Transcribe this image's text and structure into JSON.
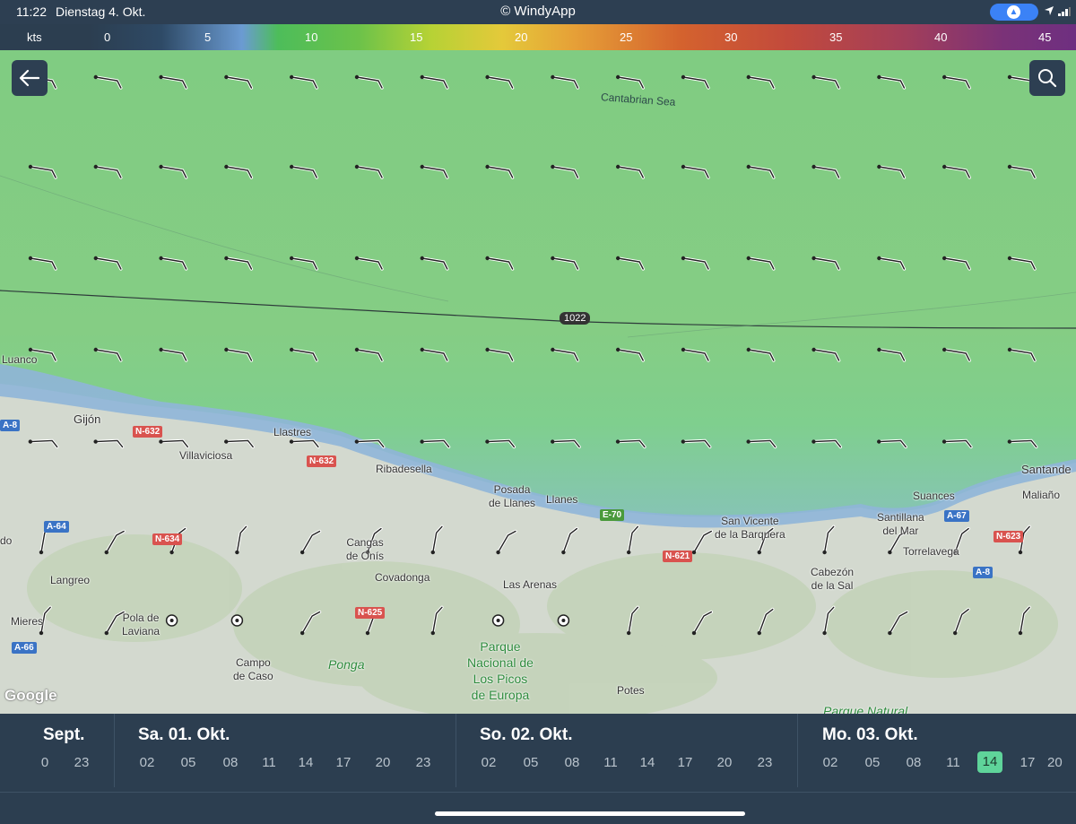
{
  "status_bar": {
    "time": "11:22",
    "date": "Dienstag 4. Okt.",
    "app_title": "© WindyApp"
  },
  "legend": {
    "unit": "kts",
    "ticks": [
      "0",
      "5",
      "10",
      "15",
      "20",
      "25",
      "30",
      "35",
      "40",
      "45"
    ]
  },
  "map": {
    "sea_name": "Cantabrian Sea",
    "isobar_value": "1022",
    "attribution": "Google",
    "places": {
      "luanco": "Luanco",
      "gijon": "Gijón",
      "villaviciosa": "Villaviciosa",
      "llastres": "Llastres",
      "ribadesella": "Ribadesella",
      "posada_1": "Posada",
      "posada_2": "de Llanes",
      "llanes": "Llanes",
      "san_vicente_1": "San Vicente",
      "san_vicente_2": "de la Barquera",
      "suances": "Suances",
      "santander": "Santande",
      "maliano": "Maliaño",
      "santillana_1": "Santillana",
      "santillana_2": "del Mar",
      "torrelavega": "Torrelavega",
      "cangas_1": "Cangas",
      "cangas_2": "de Onís",
      "covadonga": "Covadonga",
      "las_arenas": "Las Arenas",
      "cabezon_1": "Cabezón",
      "cabezon_2": "de la Sal",
      "langreo": "Langreo",
      "mieres": "Mieres",
      "pola_1": "Pola de",
      "pola_2": "Laviana",
      "campo_1": "Campo",
      "campo_2": "de Caso",
      "ponga": "Ponga",
      "park_1": "Parque",
      "park_2": "Nacional de",
      "park_3": "Los Picos",
      "park_4": "de Europa",
      "potes": "Potes",
      "parque_natural": "Parque Natural",
      "edge_do": "do"
    },
    "roads": {
      "n632a": "N-632",
      "n632b": "N-632",
      "a8": "A-8",
      "a64": "A-64",
      "n634": "N-634",
      "e70": "E-70",
      "n621": "N-621",
      "n625": "N-625",
      "a66": "A-66",
      "a67": "A-67",
      "n623": "N-623",
      "a8b": "A-8"
    }
  },
  "timeline": {
    "days": [
      {
        "label": "Sept.",
        "hours": [
          "0",
          "23"
        ]
      },
      {
        "label": "Sa. 01. Okt.",
        "hours": [
          "02",
          "05",
          "08",
          "11",
          "14",
          "17",
          "20",
          "23"
        ]
      },
      {
        "label": "So. 02. Okt.",
        "hours": [
          "02",
          "05",
          "08",
          "11",
          "14",
          "17",
          "20",
          "23"
        ]
      },
      {
        "label": "Mo. 03. Okt.",
        "hours": [
          "02",
          "05",
          "08",
          "11",
          "14",
          "17",
          "20"
        ]
      }
    ],
    "selected_hour": "14"
  },
  "colors": {
    "chrome": "#2c3e50",
    "sea_calm": "#7fcb80",
    "accent_selected": "#5fd49a",
    "nav_pill": "#3b82f6"
  },
  "icons": {
    "back": "arrow-left-icon",
    "search": "search-icon",
    "location": "location-arrow-icon",
    "signal": "signal-icon",
    "navigation": "navigation-arrow-icon"
  }
}
